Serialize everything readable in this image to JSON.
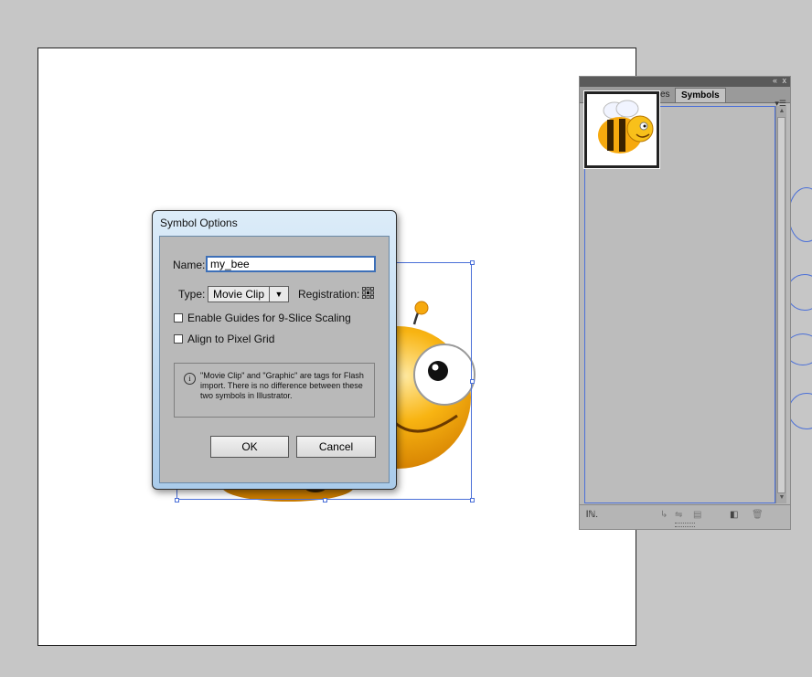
{
  "canvas": {
    "artboard": "artboard"
  },
  "symbols_panel": {
    "window_controls": [
      "«",
      "x"
    ],
    "tabs": [
      {
        "label": "es",
        "active": false
      },
      {
        "label": "Symbols",
        "active": true
      }
    ],
    "menu_icon": "panel-menu-icon",
    "symbols": [
      {
        "thumbnail_icon": "bee-icon",
        "selected": true
      }
    ],
    "footer": {
      "library_menu_label": "lℕ.",
      "icons": [
        "place-symbol-icon",
        "break-link-icon",
        "symbol-options-icon",
        "new-symbol-icon",
        "delete-symbol-icon"
      ]
    }
  },
  "dialog": {
    "title": "Symbol Options",
    "name_label": "Name:",
    "name_value": "my_bee",
    "type_label": "Type:",
    "type_value": "Movie Clip",
    "registration_label": "Registration:",
    "checkboxes": [
      {
        "label": "Enable Guides for 9-Slice Scaling",
        "checked": false
      },
      {
        "label": "Align to Pixel Grid",
        "checked": false
      }
    ],
    "info_text": "\"Movie Clip\" and \"Graphic\" are tags for Flash import. There is no difference between these two symbols in Illustrator.",
    "ok_label": "OK",
    "cancel_label": "Cancel"
  },
  "colors": {
    "workspace": "#c6c6c6",
    "selection": "#4a6fd8",
    "bee_yellow": "#f6a90e",
    "dialog_title": "#bdd8f0"
  }
}
